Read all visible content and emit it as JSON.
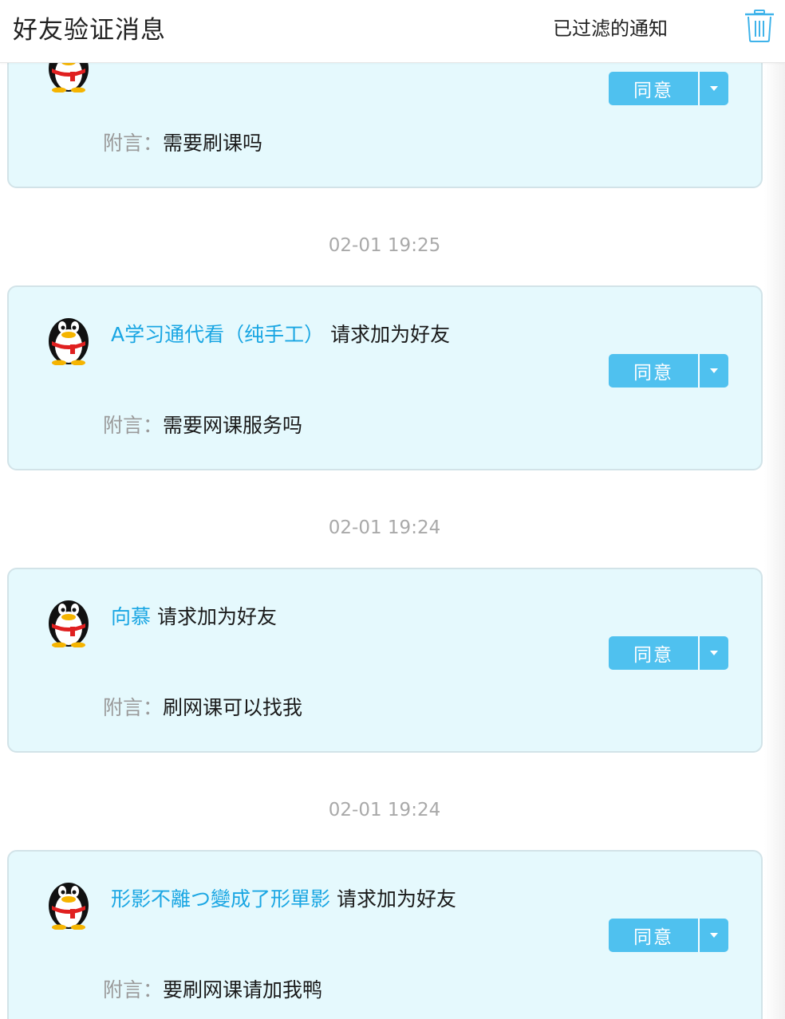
{
  "header": {
    "title": "好友验证消息",
    "filtered_label": "已过滤的通知",
    "trash_icon": "trash-icon"
  },
  "colors": {
    "accent": "#4fc1ef",
    "name_link": "#1aa6e3",
    "card_bg": "#e5f9fd",
    "card_border": "#d2e3e8",
    "timestamp": "#a9a9a9"
  },
  "requests": [
    {
      "name": "",
      "action": "",
      "agree_label": "同意",
      "note_label": "附言：",
      "note": "需要刷课吗"
    },
    {
      "timestamp": "02-01 19:25",
      "name": "A学习通代看（纯手工）",
      "action": "请求加为好友",
      "agree_label": "同意",
      "note_label": "附言：",
      "note": "需要网课服务吗"
    },
    {
      "timestamp": "02-01 19:24",
      "name": "向慕",
      "action": "请求加为好友",
      "agree_label": "同意",
      "note_label": "附言：",
      "note": "刷网课可以找我"
    },
    {
      "timestamp": "02-01 19:24",
      "name": "形影不離つ變成了形單影",
      "action": "请求加为好友",
      "agree_label": "同意",
      "note_label": "附言：",
      "note": "要刷网课请加我鸭"
    }
  ]
}
